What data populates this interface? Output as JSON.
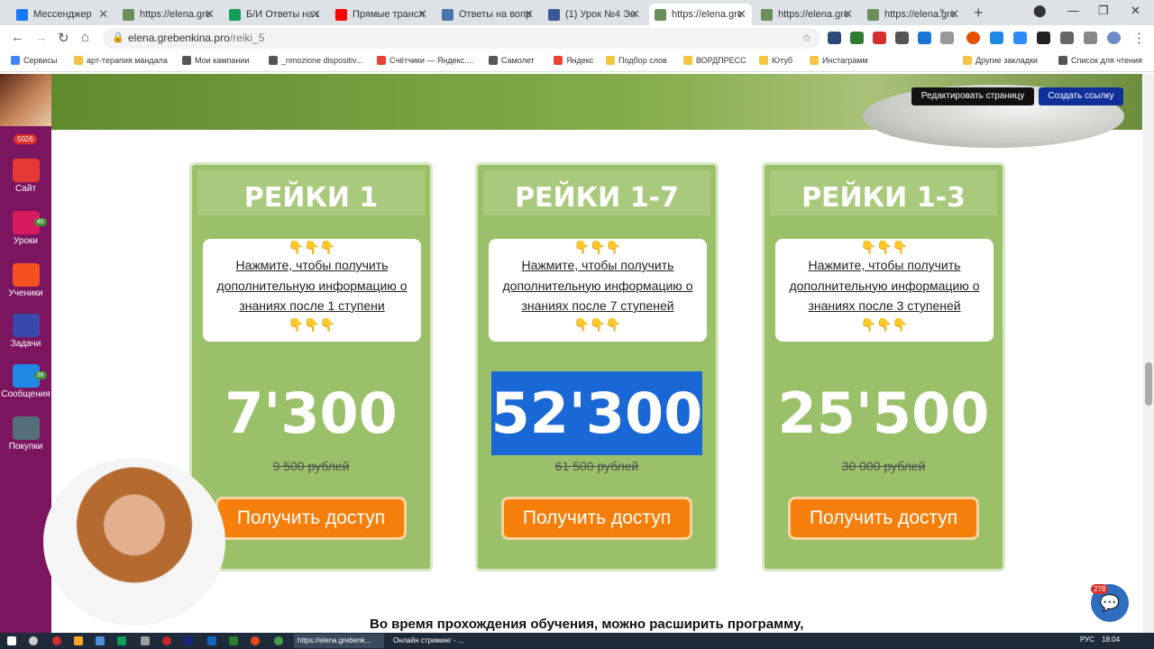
{
  "browser": {
    "tabs": [
      {
        "label": "Мессенджер",
        "color": "#1877f2",
        "active": false
      },
      {
        "label": "https://elena.gre",
        "color": "#6b8e5a",
        "active": false
      },
      {
        "label": "Б/И Ответы на в",
        "color": "#0f9d58",
        "active": false
      },
      {
        "label": "Прямые трансл",
        "color": "#ff0000",
        "active": false
      },
      {
        "label": "Ответы на вопр",
        "color": "#4a76a8",
        "active": false
      },
      {
        "label": "(1) Урок №4 Эн",
        "color": "#3b5998",
        "active": false
      },
      {
        "label": "https://elena.gre",
        "color": "#6b8e5a",
        "active": true
      },
      {
        "label": "https://elena.gre",
        "color": "#6b8e5a",
        "active": false
      },
      {
        "label": "https://elena.gre",
        "color": "#6b8e5a",
        "active": false
      }
    ],
    "url_domain": "elena.grebenkina.pro",
    "url_path": "/reiki_5",
    "bookmarks": [
      {
        "label": "Сервисы",
        "color": "#4285f4"
      },
      {
        "label": "арт-терапия мандала",
        "color": "#f4c542"
      },
      {
        "label": "Мои кампании",
        "color": "#555555"
      },
      {
        "label": "_nmozione dispositiv...",
        "color": "#555555"
      },
      {
        "label": "Счётчики — Яндекс....",
        "color": "#e94335"
      },
      {
        "label": "Самолет",
        "color": "#555555"
      },
      {
        "label": "Яндекс",
        "color": "#e94335"
      },
      {
        "label": "Подбор слов",
        "color": "#f4c542"
      },
      {
        "label": "ВОРДПРЕСС",
        "color": "#f4c542"
      },
      {
        "label": "Ютуб",
        "color": "#f4c542"
      },
      {
        "label": "Инстаграмм",
        "color": "#f4c542"
      },
      {
        "label": "Другие закладки",
        "color": "#f4c542"
      },
      {
        "label": "Список для чтения",
        "color": "#555555"
      }
    ]
  },
  "sidebar": {
    "counter": "5026",
    "items": [
      {
        "label": "Сайт",
        "icon": "house-icon",
        "badge": ""
      },
      {
        "label": "Уроки",
        "icon": "lessons-icon",
        "badge": "40"
      },
      {
        "label": "Ученики",
        "icon": "students-icon",
        "badge": ""
      },
      {
        "label": "Задачи",
        "icon": "tasks-icon",
        "badge": ""
      },
      {
        "label": "Сообщения",
        "icon": "messages-icon",
        "badge": "38"
      },
      {
        "label": "Покупки",
        "icon": "calculator-icon",
        "badge": ""
      }
    ]
  },
  "page": {
    "edit_button": "Редактировать страницу",
    "create_link_button": "Создать ссылку",
    "cards": [
      {
        "title": "РЕЙКИ 1",
        "hands": "👇👇👇",
        "info": "Нажмите, чтобы получить дополнительную информацию о знаниях после 1 ступени",
        "price": "7'300",
        "old_price": "9 500 рублей",
        "cta": "Получить доступ",
        "selected": false
      },
      {
        "title": "РЕЙКИ 1-7",
        "hands": "👇👇👇",
        "info": "Нажмите, чтобы получить дополнительную информацию о знаниях после 7 ступеней",
        "price": "52'300",
        "old_price": "61 500 рублей",
        "cta": "Получить доступ",
        "selected": true
      },
      {
        "title": "РЕЙКИ 1-3",
        "hands": "👇👇👇",
        "info": "Нажмите, чтобы получить дополнительную информацию о знаниях после 3 ступеней",
        "price": "25'500",
        "old_price": "30 000 рублей",
        "cta": "Получить доступ",
        "selected": false
      }
    ],
    "bottom_text": "Во время прохождения обучения, можно расширить программу,",
    "chat_badge": "278"
  },
  "taskbar": {
    "tasks": [
      "https://elena.grebenk...",
      "Онлайн стриминг - ..."
    ],
    "lang": "РУС",
    "time": "18:04"
  }
}
